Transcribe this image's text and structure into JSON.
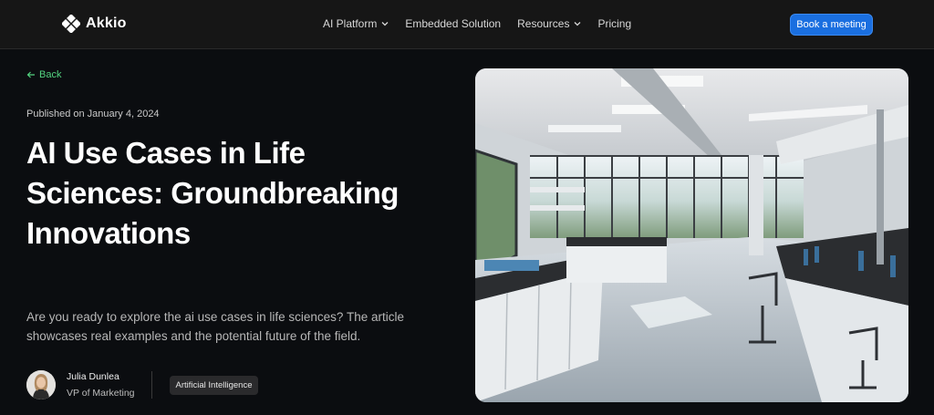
{
  "nav": {
    "logo_text": "Akkio",
    "menu": [
      {
        "label": "AI Platform",
        "has_dropdown": true
      },
      {
        "label": "Embedded Solution",
        "has_dropdown": false
      },
      {
        "label": "Resources",
        "has_dropdown": true
      },
      {
        "label": "Pricing",
        "has_dropdown": false
      }
    ],
    "cta_label": "Book a meeting"
  },
  "article": {
    "back_label": "Back",
    "published": "Published on January 4, 2024",
    "title": "AI Use Cases in Life Sciences: Groundbreaking Innovations",
    "description": "Are you ready to explore the ai use cases in life sciences? The article showcases real examples and the potential future of the field.",
    "author": {
      "name": "Julia Dunlea",
      "role": "VP of Marketing"
    },
    "tag": "Artificial Intelligence"
  },
  "colors": {
    "background": "#0b0d10",
    "nav_background": "#161616",
    "accent_green": "#53d37f",
    "cta_blue": "#1a6fe0"
  },
  "icons": {
    "logo": "akkio-diamond-logo",
    "back": "arrow-left-icon",
    "dropdown": "chevron-down-icon"
  }
}
